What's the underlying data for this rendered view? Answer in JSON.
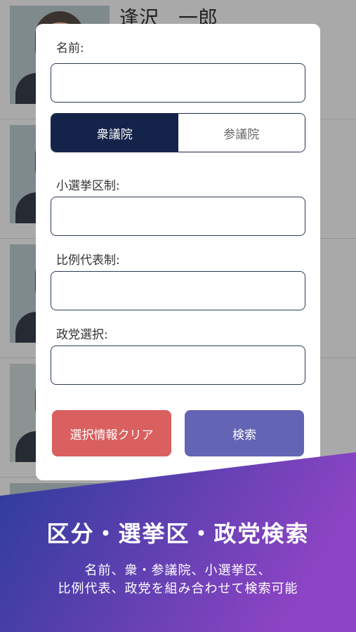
{
  "background_list": {
    "first_name": "逢沢　一郎"
  },
  "search_form": {
    "name_label": "名前:",
    "name_value": "",
    "chamber_options": [
      "衆議院",
      "参議院"
    ],
    "chamber_selected": "衆議院",
    "district_label": "小選挙区制:",
    "district_value": "",
    "proportional_label": "比例代表制:",
    "proportional_value": "",
    "party_label": "政党選択:",
    "party_value": "",
    "clear_button": "選択情報クリア",
    "search_button": "検索"
  },
  "banner": {
    "title": "区分・選挙区・政党検索",
    "subtitle_line1": "名前、衆・参議院、小選挙区、",
    "subtitle_line2": "比例代表、政党を組み合わせて検索可能"
  },
  "colors": {
    "clear_button": "#d9605f",
    "search_button": "#6464b4",
    "segment_active": "#14234a",
    "banner_gradient_start": "#2b3c9c",
    "banner_gradient_end": "#8d44c4"
  }
}
